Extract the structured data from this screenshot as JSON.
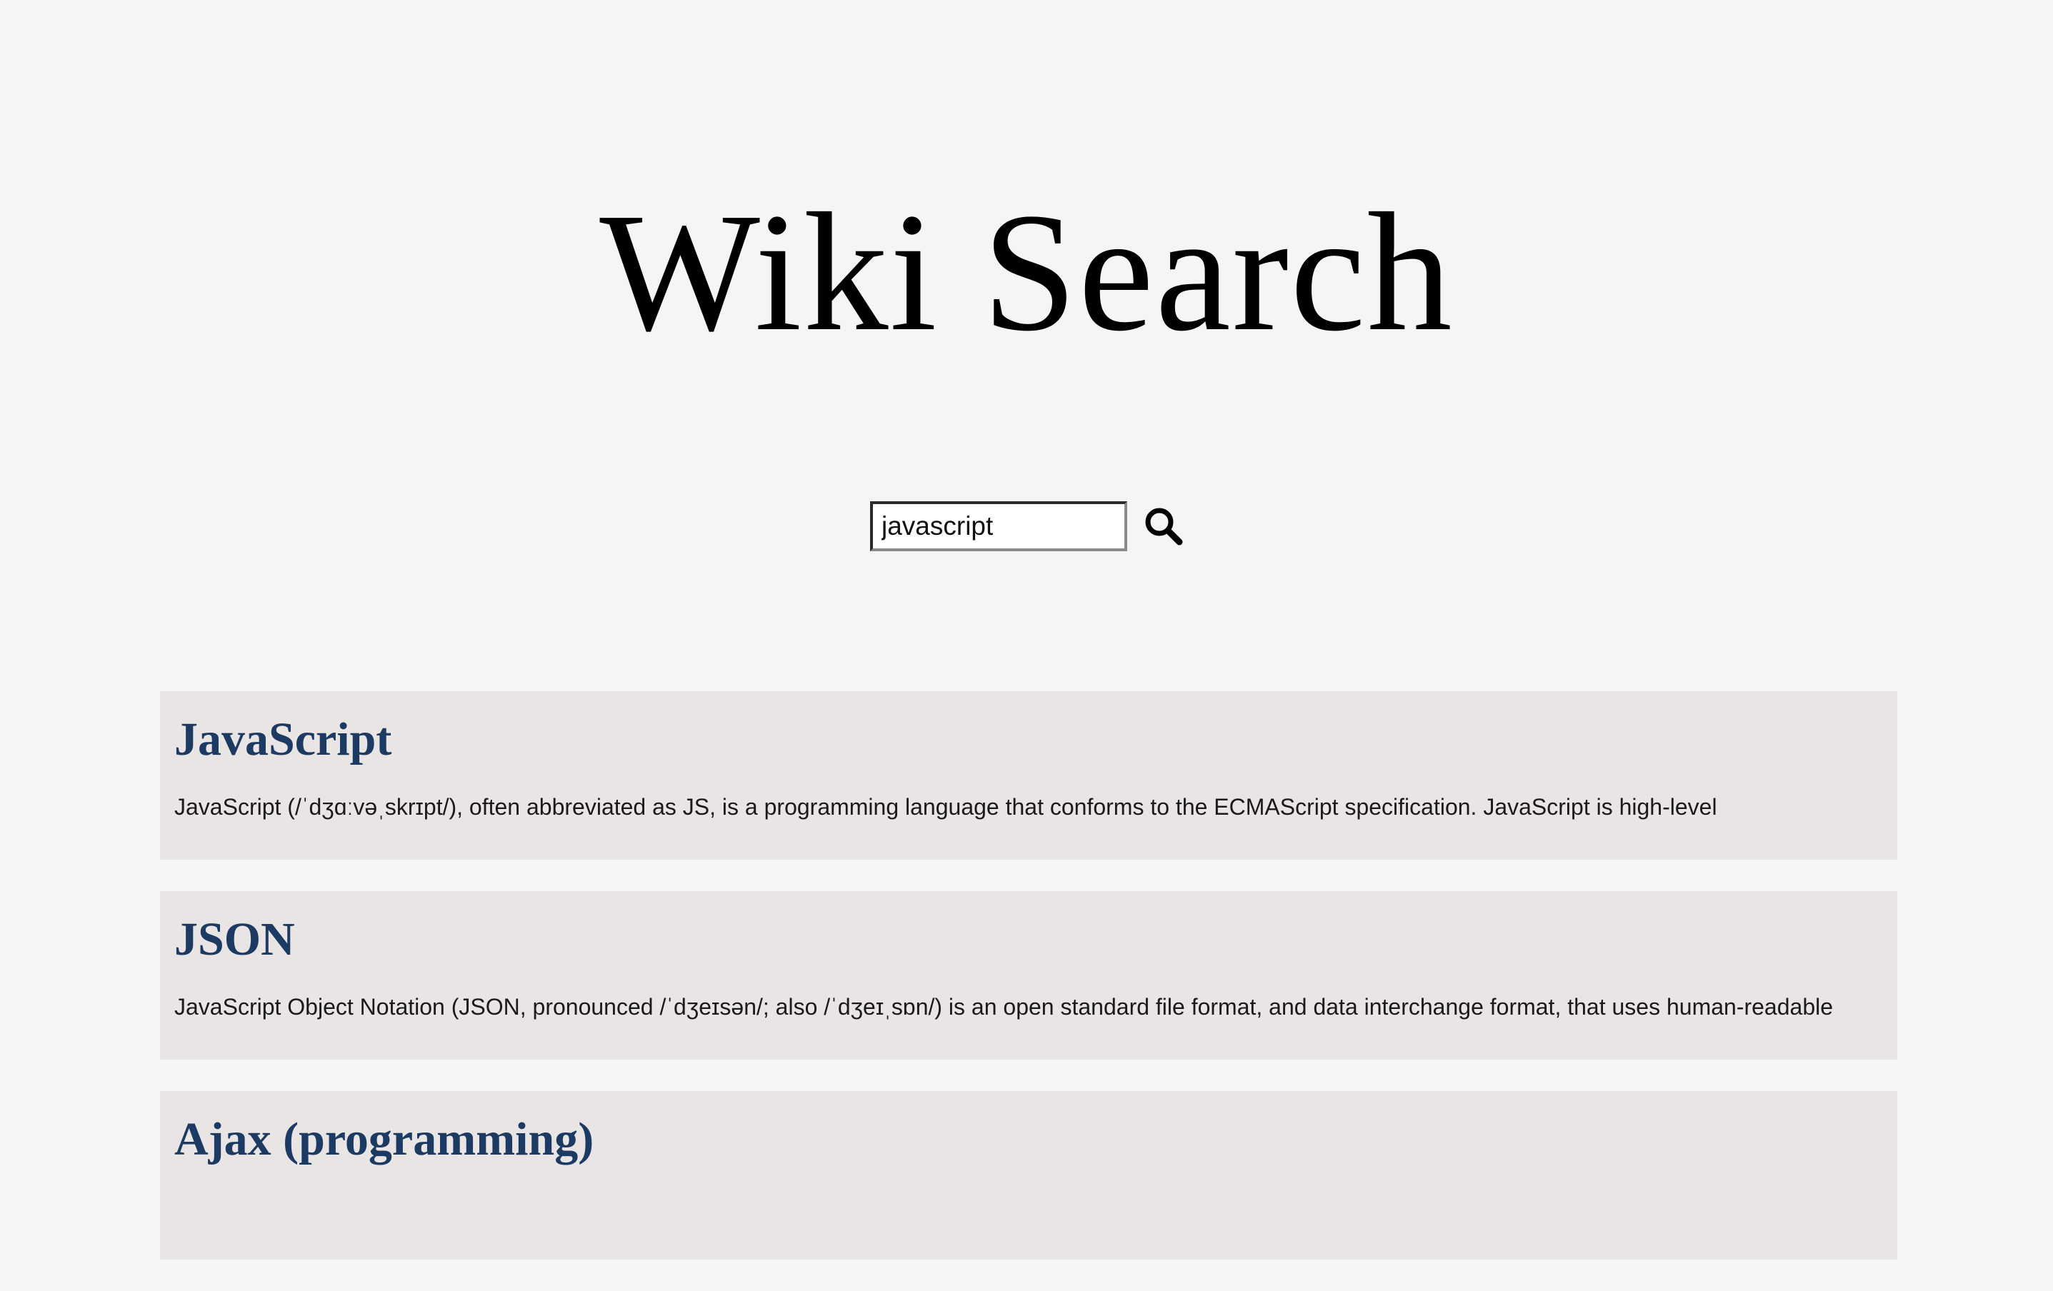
{
  "header": {
    "title": "Wiki Search"
  },
  "search": {
    "value": "javascript",
    "button_icon": "search-icon"
  },
  "results": [
    {
      "title": "JavaScript",
      "snippet": "JavaScript (/ˈdʒɑːvəˌskrɪpt/), often abbreviated as JS, is a programming language that conforms to the ECMAScript specification. JavaScript is high-level"
    },
    {
      "title": "JSON",
      "snippet": "JavaScript Object Notation (JSON, pronounced /ˈdʒeɪsən/; also /ˈdʒeɪˌsɒn/) is an open standard file format, and data interchange format, that uses human-readable"
    },
    {
      "title": "Ajax (programming)",
      "snippet": ""
    }
  ],
  "colors": {
    "background": "#f5f5f5",
    "card_background": "#e8e5e4",
    "result_title": "#1c3a62"
  }
}
